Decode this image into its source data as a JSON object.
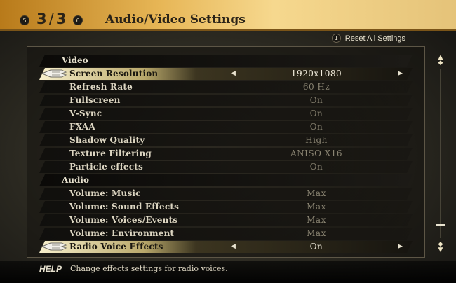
{
  "header": {
    "left_shoulder": "5",
    "page_current": "3",
    "page_total": "3",
    "right_shoulder": "6",
    "title": "Audio/Video Settings"
  },
  "reset": {
    "button_glyph": "1",
    "label": "Reset All Settings"
  },
  "sections": {
    "video": "Video",
    "audio": "Audio"
  },
  "video_settings": [
    {
      "label": "Screen Resolution",
      "value": "1920x1080"
    },
    {
      "label": "Refresh Rate",
      "value": "60 Hz"
    },
    {
      "label": "Fullscreen",
      "value": "On"
    },
    {
      "label": "V-Sync",
      "value": "On"
    },
    {
      "label": "FXAA",
      "value": "On"
    },
    {
      "label": "Shadow Quality",
      "value": "High"
    },
    {
      "label": "Texture Filtering",
      "value": "ANISO X16"
    },
    {
      "label": "Particle effects",
      "value": "On"
    }
  ],
  "audio_settings": [
    {
      "label": "Volume: Music",
      "value": "Max"
    },
    {
      "label": "Volume: Sound Effects",
      "value": "Max"
    },
    {
      "label": "Volume: Voices/Events",
      "value": "Max"
    },
    {
      "label": "Volume: Environment",
      "value": "Max"
    },
    {
      "label": "Radio Voice Effects",
      "value": "On"
    }
  ],
  "help": {
    "tag": "HELP",
    "text": "Change effects settings for radio voices."
  },
  "icons": {
    "cursor": "hand-cursor-icon",
    "left_arrow": "left-arrow-icon",
    "right_arrow": "right-arrow-icon",
    "scroll_up": "scroll-up-icon",
    "scroll_down": "scroll-down-icon"
  }
}
